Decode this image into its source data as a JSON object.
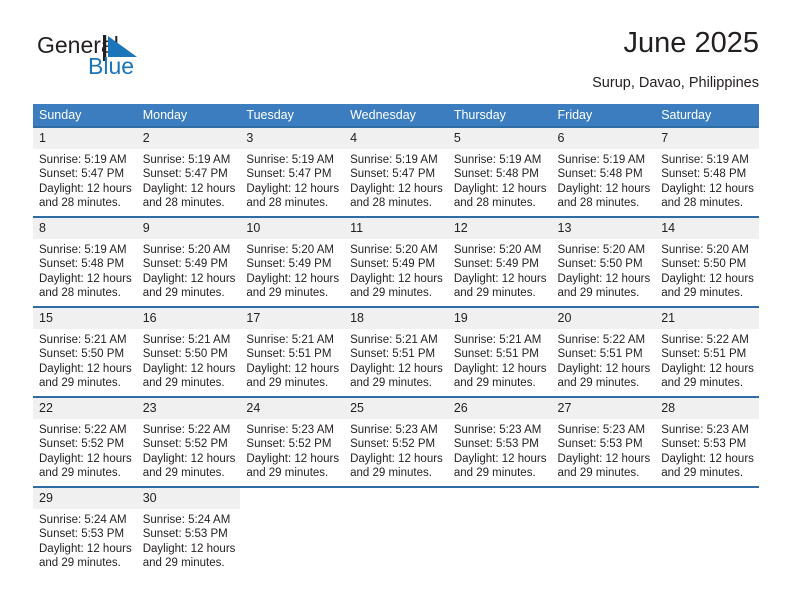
{
  "brand": {
    "name_part1": "General",
    "name_part2": "Blue",
    "mark": "triangle-flag-logo",
    "color_dark": "#231f20",
    "color_blue": "#1b75bb"
  },
  "header": {
    "title": "June 2025",
    "subtitle": "Surup, Davao, Philippines"
  },
  "theme": {
    "header_row_bg": "#3b7dbf",
    "week_divider": "#2e6da4",
    "daynum_bg": "#f0f0f0",
    "text": "#231f20"
  },
  "weekday_headers": [
    "Sunday",
    "Monday",
    "Tuesday",
    "Wednesday",
    "Thursday",
    "Friday",
    "Saturday"
  ],
  "weeks": [
    [
      {
        "day": "1",
        "sunrise": "Sunrise: 5:19 AM",
        "sunset": "Sunset: 5:47 PM",
        "daylight1": "Daylight: 12 hours",
        "daylight2": "and 28 minutes."
      },
      {
        "day": "2",
        "sunrise": "Sunrise: 5:19 AM",
        "sunset": "Sunset: 5:47 PM",
        "daylight1": "Daylight: 12 hours",
        "daylight2": "and 28 minutes."
      },
      {
        "day": "3",
        "sunrise": "Sunrise: 5:19 AM",
        "sunset": "Sunset: 5:47 PM",
        "daylight1": "Daylight: 12 hours",
        "daylight2": "and 28 minutes."
      },
      {
        "day": "4",
        "sunrise": "Sunrise: 5:19 AM",
        "sunset": "Sunset: 5:47 PM",
        "daylight1": "Daylight: 12 hours",
        "daylight2": "and 28 minutes."
      },
      {
        "day": "5",
        "sunrise": "Sunrise: 5:19 AM",
        "sunset": "Sunset: 5:48 PM",
        "daylight1": "Daylight: 12 hours",
        "daylight2": "and 28 minutes."
      },
      {
        "day": "6",
        "sunrise": "Sunrise: 5:19 AM",
        "sunset": "Sunset: 5:48 PM",
        "daylight1": "Daylight: 12 hours",
        "daylight2": "and 28 minutes."
      },
      {
        "day": "7",
        "sunrise": "Sunrise: 5:19 AM",
        "sunset": "Sunset: 5:48 PM",
        "daylight1": "Daylight: 12 hours",
        "daylight2": "and 28 minutes."
      }
    ],
    [
      {
        "day": "8",
        "sunrise": "Sunrise: 5:19 AM",
        "sunset": "Sunset: 5:48 PM",
        "daylight1": "Daylight: 12 hours",
        "daylight2": "and 28 minutes."
      },
      {
        "day": "9",
        "sunrise": "Sunrise: 5:20 AM",
        "sunset": "Sunset: 5:49 PM",
        "daylight1": "Daylight: 12 hours",
        "daylight2": "and 29 minutes."
      },
      {
        "day": "10",
        "sunrise": "Sunrise: 5:20 AM",
        "sunset": "Sunset: 5:49 PM",
        "daylight1": "Daylight: 12 hours",
        "daylight2": "and 29 minutes."
      },
      {
        "day": "11",
        "sunrise": "Sunrise: 5:20 AM",
        "sunset": "Sunset: 5:49 PM",
        "daylight1": "Daylight: 12 hours",
        "daylight2": "and 29 minutes."
      },
      {
        "day": "12",
        "sunrise": "Sunrise: 5:20 AM",
        "sunset": "Sunset: 5:49 PM",
        "daylight1": "Daylight: 12 hours",
        "daylight2": "and 29 minutes."
      },
      {
        "day": "13",
        "sunrise": "Sunrise: 5:20 AM",
        "sunset": "Sunset: 5:50 PM",
        "daylight1": "Daylight: 12 hours",
        "daylight2": "and 29 minutes."
      },
      {
        "day": "14",
        "sunrise": "Sunrise: 5:20 AM",
        "sunset": "Sunset: 5:50 PM",
        "daylight1": "Daylight: 12 hours",
        "daylight2": "and 29 minutes."
      }
    ],
    [
      {
        "day": "15",
        "sunrise": "Sunrise: 5:21 AM",
        "sunset": "Sunset: 5:50 PM",
        "daylight1": "Daylight: 12 hours",
        "daylight2": "and 29 minutes."
      },
      {
        "day": "16",
        "sunrise": "Sunrise: 5:21 AM",
        "sunset": "Sunset: 5:50 PM",
        "daylight1": "Daylight: 12 hours",
        "daylight2": "and 29 minutes."
      },
      {
        "day": "17",
        "sunrise": "Sunrise: 5:21 AM",
        "sunset": "Sunset: 5:51 PM",
        "daylight1": "Daylight: 12 hours",
        "daylight2": "and 29 minutes."
      },
      {
        "day": "18",
        "sunrise": "Sunrise: 5:21 AM",
        "sunset": "Sunset: 5:51 PM",
        "daylight1": "Daylight: 12 hours",
        "daylight2": "and 29 minutes."
      },
      {
        "day": "19",
        "sunrise": "Sunrise: 5:21 AM",
        "sunset": "Sunset: 5:51 PM",
        "daylight1": "Daylight: 12 hours",
        "daylight2": "and 29 minutes."
      },
      {
        "day": "20",
        "sunrise": "Sunrise: 5:22 AM",
        "sunset": "Sunset: 5:51 PM",
        "daylight1": "Daylight: 12 hours",
        "daylight2": "and 29 minutes."
      },
      {
        "day": "21",
        "sunrise": "Sunrise: 5:22 AM",
        "sunset": "Sunset: 5:51 PM",
        "daylight1": "Daylight: 12 hours",
        "daylight2": "and 29 minutes."
      }
    ],
    [
      {
        "day": "22",
        "sunrise": "Sunrise: 5:22 AM",
        "sunset": "Sunset: 5:52 PM",
        "daylight1": "Daylight: 12 hours",
        "daylight2": "and 29 minutes."
      },
      {
        "day": "23",
        "sunrise": "Sunrise: 5:22 AM",
        "sunset": "Sunset: 5:52 PM",
        "daylight1": "Daylight: 12 hours",
        "daylight2": "and 29 minutes."
      },
      {
        "day": "24",
        "sunrise": "Sunrise: 5:23 AM",
        "sunset": "Sunset: 5:52 PM",
        "daylight1": "Daylight: 12 hours",
        "daylight2": "and 29 minutes."
      },
      {
        "day": "25",
        "sunrise": "Sunrise: 5:23 AM",
        "sunset": "Sunset: 5:52 PM",
        "daylight1": "Daylight: 12 hours",
        "daylight2": "and 29 minutes."
      },
      {
        "day": "26",
        "sunrise": "Sunrise: 5:23 AM",
        "sunset": "Sunset: 5:53 PM",
        "daylight1": "Daylight: 12 hours",
        "daylight2": "and 29 minutes."
      },
      {
        "day": "27",
        "sunrise": "Sunrise: 5:23 AM",
        "sunset": "Sunset: 5:53 PM",
        "daylight1": "Daylight: 12 hours",
        "daylight2": "and 29 minutes."
      },
      {
        "day": "28",
        "sunrise": "Sunrise: 5:23 AM",
        "sunset": "Sunset: 5:53 PM",
        "daylight1": "Daylight: 12 hours",
        "daylight2": "and 29 minutes."
      }
    ],
    [
      {
        "day": "29",
        "sunrise": "Sunrise: 5:24 AM",
        "sunset": "Sunset: 5:53 PM",
        "daylight1": "Daylight: 12 hours",
        "daylight2": "and 29 minutes."
      },
      {
        "day": "30",
        "sunrise": "Sunrise: 5:24 AM",
        "sunset": "Sunset: 5:53 PM",
        "daylight1": "Daylight: 12 hours",
        "daylight2": "and 29 minutes."
      },
      {
        "day": "",
        "sunrise": "",
        "sunset": "",
        "daylight1": "",
        "daylight2": ""
      },
      {
        "day": "",
        "sunrise": "",
        "sunset": "",
        "daylight1": "",
        "daylight2": ""
      },
      {
        "day": "",
        "sunrise": "",
        "sunset": "",
        "daylight1": "",
        "daylight2": ""
      },
      {
        "day": "",
        "sunrise": "",
        "sunset": "",
        "daylight1": "",
        "daylight2": ""
      },
      {
        "day": "",
        "sunrise": "",
        "sunset": "",
        "daylight1": "",
        "daylight2": ""
      }
    ]
  ]
}
